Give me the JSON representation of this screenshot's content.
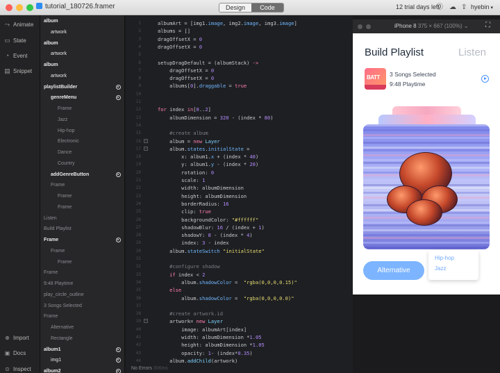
{
  "window": {
    "file_name": "tutorial_180726.framer",
    "mode_tabs": [
      "Design",
      "Code"
    ],
    "trial_text": "12 trial days left",
    "user": "hyebin"
  },
  "left_nav": {
    "top": [
      {
        "label": "Animate",
        "icon": "animate-icon",
        "glyph": "⤳"
      },
      {
        "label": "State",
        "icon": "state-icon",
        "glyph": "▭"
      },
      {
        "label": "Event",
        "icon": "event-icon",
        "glyph": "◔"
      },
      {
        "label": "Snippet",
        "icon": "snippet-icon",
        "glyph": "▤"
      }
    ],
    "bottom": [
      {
        "label": "Import",
        "icon": "import-icon",
        "glyph": "⊕"
      },
      {
        "label": "Docs",
        "icon": "docs-icon",
        "glyph": "▣"
      },
      {
        "label": "Inspect",
        "icon": "inspect-icon",
        "glyph": "⊙"
      }
    ]
  },
  "layers": [
    {
      "label": "album",
      "indent": 0,
      "color": "#e8e8e8",
      "radio": false,
      "bold": true
    },
    {
      "label": "artwork",
      "indent": 1,
      "color": "#e8e8e8",
      "radio": false,
      "bold": false
    },
    {
      "label": "album",
      "indent": 0,
      "color": "#e8e8e8",
      "radio": false,
      "bold": true
    },
    {
      "label": "artwork",
      "indent": 1,
      "color": "#e8e8e8",
      "radio": false,
      "bold": false
    },
    {
      "label": "album",
      "indent": 0,
      "color": "#e8e8e8",
      "radio": false,
      "bold": true
    },
    {
      "label": "artwork",
      "indent": 1,
      "color": "#e8e8e8",
      "radio": false,
      "bold": false
    },
    {
      "label": "playlistBuilder",
      "indent": 0,
      "color": "#e8e8e8",
      "radio": true,
      "bold": true
    },
    {
      "label": "genreMenu",
      "indent": 1,
      "color": "#e8e8e8",
      "radio": true,
      "bold": true
    },
    {
      "label": "Frame",
      "indent": 2,
      "color": "#8d8d92",
      "radio": false,
      "bold": false
    },
    {
      "label": "Jazz",
      "indent": 2,
      "color": "#8d8d92",
      "radio": false,
      "bold": false
    },
    {
      "label": "Hip-hop",
      "indent": 2,
      "color": "#8d8d92",
      "radio": false,
      "bold": false
    },
    {
      "label": "Electronic",
      "indent": 2,
      "color": "#8d8d92",
      "radio": false,
      "bold": false
    },
    {
      "label": "Dance",
      "indent": 2,
      "color": "#8d8d92",
      "radio": false,
      "bold": false
    },
    {
      "label": "Country",
      "indent": 2,
      "color": "#8d8d92",
      "radio": false,
      "bold": false
    },
    {
      "label": "addGenreButton",
      "indent": 1,
      "color": "#e8e8e8",
      "radio": true,
      "bold": true
    },
    {
      "label": "Frame",
      "indent": 1,
      "color": "#8d8d92",
      "radio": false,
      "bold": false
    },
    {
      "label": "Frame",
      "indent": 2,
      "color": "#8d8d92",
      "radio": false,
      "bold": false
    },
    {
      "label": "Frame",
      "indent": 2,
      "color": "#8d8d92",
      "radio": false,
      "bold": false
    },
    {
      "label": "Listen",
      "indent": 0,
      "color": "#8d8d92",
      "radio": false,
      "bold": false
    },
    {
      "label": "Build Playlist",
      "indent": 0,
      "color": "#8d8d92",
      "radio": false,
      "bold": false
    },
    {
      "label": "Frame",
      "indent": 0,
      "color": "#e8e8e8",
      "radio": true,
      "bold": true
    },
    {
      "label": "Frame",
      "indent": 1,
      "color": "#8d8d92",
      "radio": false,
      "bold": false
    },
    {
      "label": "Frame",
      "indent": 2,
      "color": "#8d8d92",
      "radio": false,
      "bold": false
    },
    {
      "label": "Frame",
      "indent": 0,
      "color": "#8d8d92",
      "radio": false,
      "bold": false
    },
    {
      "label": "9:48 Playtime",
      "indent": 0,
      "color": "#8d8d92",
      "radio": false,
      "bold": false
    },
    {
      "label": "play_circle_outline",
      "indent": 0,
      "color": "#8d8d92",
      "radio": false,
      "bold": false
    },
    {
      "label": "3 Songs Selected",
      "indent": 0,
      "color": "#8d8d92",
      "radio": false,
      "bold": false
    },
    {
      "label": "Frame",
      "indent": 0,
      "color": "#8d8d92",
      "radio": false,
      "bold": false
    },
    {
      "label": "Alternative",
      "indent": 1,
      "color": "#8d8d92",
      "radio": false,
      "bold": false
    },
    {
      "label": "Rectangle",
      "indent": 1,
      "color": "#8d8d92",
      "radio": false,
      "bold": false
    },
    {
      "label": "album1",
      "indent": 0,
      "color": "#e8e8e8",
      "radio": true,
      "bold": true
    },
    {
      "label": "img1",
      "indent": 1,
      "color": "#e8e8e8",
      "radio": true,
      "bold": false
    },
    {
      "label": "album2",
      "indent": 0,
      "color": "#e8e8e8",
      "radio": true,
      "bold": true
    }
  ],
  "code_lines": [
    {
      "n": 1,
      "fold": false,
      "html": "albumArt = [img1.<span class='c-prop'>image</span>, img2.<span class='c-prop'>image</span>, img3.<span class='c-prop'>image</span>]"
    },
    {
      "n": 2,
      "fold": false,
      "html": "albums = []"
    },
    {
      "n": 3,
      "fold": false,
      "html": "dragOffsetX = <span class='c-num'>0</span>"
    },
    {
      "n": 4,
      "fold": false,
      "html": "dragOffsetX = <span class='c-num'>0</span>"
    },
    {
      "n": 5,
      "fold": false,
      "html": ""
    },
    {
      "n": 6,
      "fold": false,
      "html": "setupDragDefault = (albumStack) <span class='c-pink'>-&gt;</span>"
    },
    {
      "n": 7,
      "fold": false,
      "html": "    dragOffsetX = <span class='c-num'>0</span>"
    },
    {
      "n": 8,
      "fold": false,
      "html": "    dragOffsetX = <span class='c-num'>0</span>"
    },
    {
      "n": 9,
      "fold": false,
      "html": "    albums[<span class='c-num'>0</span>].<span class='c-prop'>draggable</span> = <span class='c-kw'>true</span>"
    },
    {
      "n": 10,
      "fold": false,
      "html": ""
    },
    {
      "n": 11,
      "fold": false,
      "html": ""
    },
    {
      "n": 12,
      "fold": false,
      "html": "<span class='c-kw'>for</span> index <span class='c-kw'>in</span>[<span class='c-num'>0</span>..<span class='c-num'>2</span>]"
    },
    {
      "n": 13,
      "fold": false,
      "html": "    albumDimension = <span class='c-num'>320</span> - (index * <span class='c-num'>80</span>)"
    },
    {
      "n": 14,
      "fold": false,
      "html": ""
    },
    {
      "n": 15,
      "fold": false,
      "html": "    <span class='c-com'>#create album</span>"
    },
    {
      "n": 16,
      "fold": true,
      "html": "    album = <span class='c-kw'>new</span> <span class='c-fn'>Layer</span>"
    },
    {
      "n": 17,
      "fold": true,
      "html": "    album.<span class='c-prop'>states</span>.<span class='c-prop'>initialState</span> ="
    },
    {
      "n": 18,
      "fold": false,
      "html": "        x: album1.<span class='c-prop'>x</span> + (index * <span class='c-num'>40</span>)"
    },
    {
      "n": 19,
      "fold": false,
      "html": "        y: album1.<span class='c-prop'>y</span> - (index * <span class='c-num'>20</span>)"
    },
    {
      "n": 20,
      "fold": false,
      "html": "        rotation: <span class='c-num'>0</span>"
    },
    {
      "n": 21,
      "fold": false,
      "html": "        scale: <span class='c-num'>1</span>"
    },
    {
      "n": 22,
      "fold": false,
      "html": "        width: albumDimension"
    },
    {
      "n": 23,
      "fold": false,
      "html": "        height: albumDimension"
    },
    {
      "n": 24,
      "fold": false,
      "html": "        borderRadius: <span class='c-num'>16</span>"
    },
    {
      "n": 25,
      "fold": false,
      "html": "        clip: <span class='c-kw'>true</span>"
    },
    {
      "n": 26,
      "fold": false,
      "html": "        backgroundColor: <span class='c-str'>\"#ffffff\"</span>"
    },
    {
      "n": 27,
      "fold": false,
      "html": "        shadowBlur: <span class='c-num'>16</span> / (index + <span class='c-num'>1</span>)"
    },
    {
      "n": 28,
      "fold": false,
      "html": "        shadowY: <span class='c-num'>8</span> - (index * <span class='c-num'>4</span>)"
    },
    {
      "n": 29,
      "fold": false,
      "html": "        index: <span class='c-num'>3</span> - index"
    },
    {
      "n": 30,
      "fold": false,
      "html": "    album.<span class='c-prop'>stateSwitch</span> <span class='c-str'>\"initialState\"</span>"
    },
    {
      "n": 31,
      "fold": false,
      "html": ""
    },
    {
      "n": 32,
      "fold": false,
      "html": "    <span class='c-com'>#configure shadow</span>"
    },
    {
      "n": 33,
      "fold": false,
      "html": "    <span class='c-kw'>if</span> index &lt; <span class='c-num'>2</span>"
    },
    {
      "n": 34,
      "fold": false,
      "html": "        album.<span class='c-prop'>shadowColor</span> =  <span class='c-str'>\"rgba(0,0,0,0.15)\"</span>"
    },
    {
      "n": 35,
      "fold": false,
      "html": "    <span class='c-kw'>else</span>"
    },
    {
      "n": 36,
      "fold": false,
      "html": "        album.<span class='c-prop'>shadowColor</span> =  <span class='c-str'>\"rgba(0,0,0,0.0)\"</span>"
    },
    {
      "n": 37,
      "fold": false,
      "html": ""
    },
    {
      "n": 38,
      "fold": false,
      "html": "    <span class='c-com'>#create artwork.id</span>"
    },
    {
      "n": 39,
      "fold": true,
      "html": "    artwork= <span class='c-kw'>new</span> <span class='c-fn'>Layer</span>"
    },
    {
      "n": 40,
      "fold": false,
      "html": "        image: albumArt[index]"
    },
    {
      "n": 41,
      "fold": false,
      "html": "        width: albumDimension *<span class='c-num'>1.05</span>"
    },
    {
      "n": 42,
      "fold": false,
      "html": "        height: albumDimension *<span class='c-num'>1.05</span>"
    },
    {
      "n": 43,
      "fold": false,
      "html": "        opacity: <span class='c-num'>1</span>- (index*<span class='c-num'>0.35</span>)"
    },
    {
      "n": 44,
      "fold": false,
      "html": "    album.<span class='c-fn'>addChild</span>(artwork)"
    }
  ],
  "status": {
    "errors": "No Errors",
    "time": "306ms"
  },
  "preview": {
    "device": "iPhone 8",
    "resolution": "375 × 667 (100%)",
    "title": "Build Playlist",
    "listen": "Listen",
    "songs_selected": "3 Songs Selected",
    "playtime": "9:48 Playtime",
    "alt_button": "Alternative",
    "genres": [
      "Hip-hop",
      "Jazz"
    ]
  }
}
